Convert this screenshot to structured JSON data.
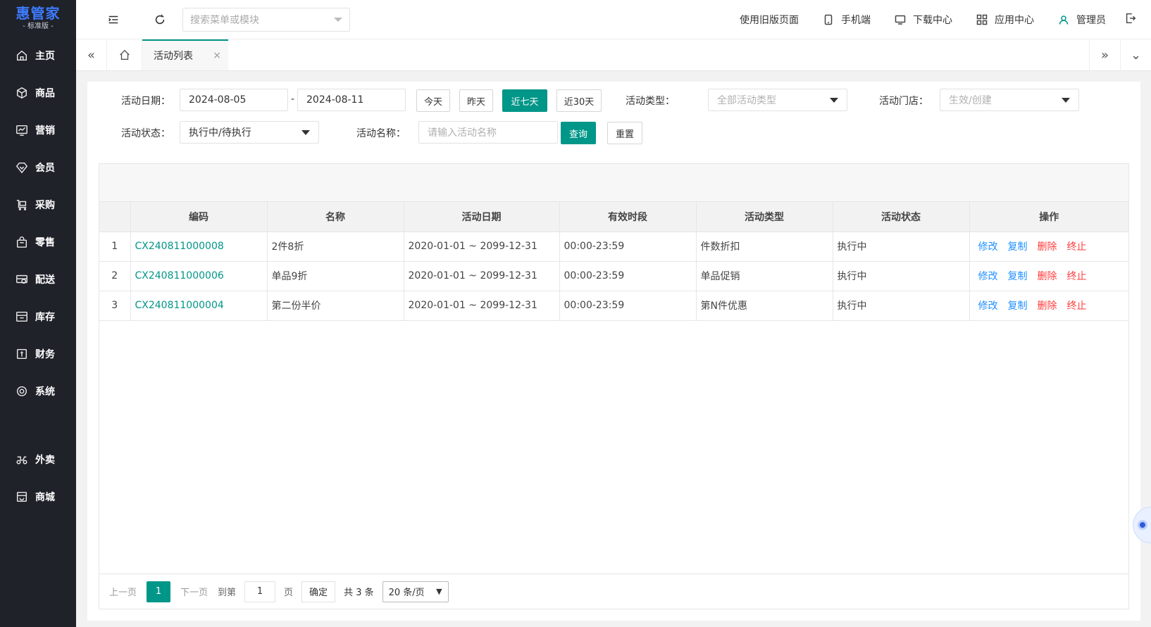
{
  "logo": {
    "main": "惠管家",
    "sub": "- 标准版 -"
  },
  "sidebar": {
    "items": [
      {
        "label": "主页",
        "icon": "home-icon"
      },
      {
        "label": "商品",
        "icon": "box-icon"
      },
      {
        "label": "营销",
        "icon": "chart-icon"
      },
      {
        "label": "会员",
        "icon": "diamond-icon"
      },
      {
        "label": "采购",
        "icon": "cart-icon"
      },
      {
        "label": "零售",
        "icon": "bag-icon"
      },
      {
        "label": "配送",
        "icon": "truck-icon"
      },
      {
        "label": "库存",
        "icon": "warehouse-icon"
      },
      {
        "label": "财务",
        "icon": "finance-icon"
      },
      {
        "label": "系统",
        "icon": "settings-icon"
      }
    ],
    "extra_items": [
      {
        "label": "外卖",
        "icon": "scooter-icon"
      },
      {
        "label": "商城",
        "icon": "store-icon"
      }
    ]
  },
  "header": {
    "search_placeholder": "搜索菜单或模块",
    "old_page": "使用旧版页面",
    "mobile": "手机端",
    "download": "下载中心",
    "apps": "应用中心",
    "user": "管理员"
  },
  "tabs": {
    "active_label": "活动列表",
    "close": "×",
    "collapse_left": "«",
    "expand_right": "»",
    "more": "⌄"
  },
  "filter": {
    "date_label": "活动日期：",
    "date_start": "2024-08-05",
    "date_sep": "-",
    "date_end": "2024-08-11",
    "today": "今天",
    "yesterday": "昨天",
    "last7": "近七天",
    "last30": "近30天",
    "type_label": "活动类型：",
    "type_placeholder": "全部活动类型",
    "store_label": "活动门店：",
    "store_placeholder": "生效/创建",
    "status_label": "活动状态：",
    "status_value": "执行中/待执行",
    "name_label": "活动名称：",
    "name_placeholder": "请输入活动名称",
    "query": "查询",
    "reset": "重置"
  },
  "table": {
    "headers": [
      "",
      "编码",
      "名称",
      "活动日期",
      "有效时段",
      "活动类型",
      "活动状态",
      "操作"
    ],
    "rows": [
      {
        "idx": "1",
        "code": "CX240811000008",
        "name": "2件8折",
        "date": "2020-01-01 ~ 2099-12-31",
        "period": "00:00-23:59",
        "type": "件数折扣",
        "status": "执行中"
      },
      {
        "idx": "2",
        "code": "CX240811000006",
        "name": "单品9折",
        "date": "2020-01-01 ~ 2099-12-31",
        "period": "00:00-23:59",
        "type": "单品促销",
        "status": "执行中"
      },
      {
        "idx": "3",
        "code": "CX240811000004",
        "name": "第二份半价",
        "date": "2020-01-01 ~ 2099-12-31",
        "period": "00:00-23:59",
        "type": "第N件优惠",
        "status": "执行中"
      }
    ],
    "ops": {
      "edit": "修改",
      "copy": "复制",
      "delete": "删除",
      "stop": "终止"
    }
  },
  "pager": {
    "prev": "上一页",
    "current": "1",
    "next": "下一页",
    "goto": "到第",
    "page_value": "1",
    "page_unit": "页",
    "confirm": "确定",
    "total": "共 3 条",
    "page_size": "20 条/页"
  },
  "colors": {
    "primary": "#009688",
    "sidebar": "#20222a",
    "link": "#1e90ff",
    "danger": "#ff3a3a",
    "logo": "#3d7bff"
  }
}
